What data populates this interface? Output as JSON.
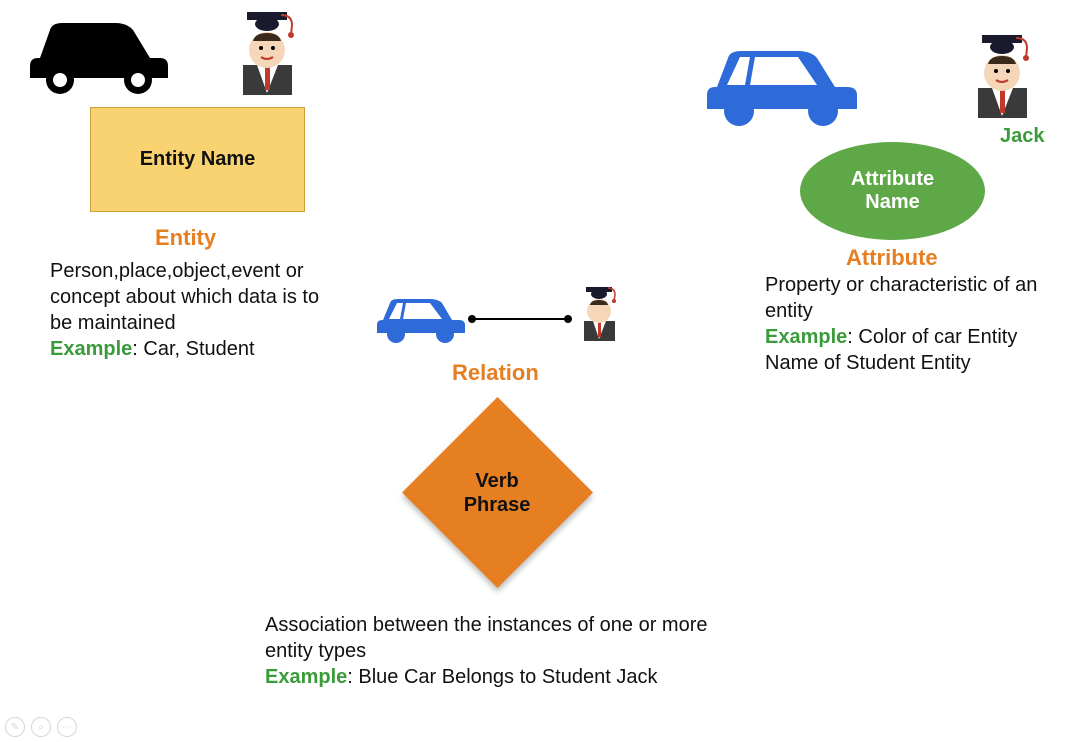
{
  "entity": {
    "box_label": "Entity Name",
    "section_label": "Entity",
    "description": "Person,place,object,event or concept about which data is to be maintained",
    "example_label": "Example",
    "example_text": ": Car, Student"
  },
  "attribute": {
    "ellipse_line1": "Attribute",
    "ellipse_line2": "Name",
    "section_label": "Attribute",
    "jack_label": "Jack",
    "description": "Property or characteristic of an entity",
    "example_label": "Example",
    "example_text": ": Color of car Entity Name of Student Entity"
  },
  "relation": {
    "diamond_line1": "Verb",
    "diamond_line2": "Phrase",
    "section_label": "Relation",
    "description": "Association between the instances of one or more entity types",
    "example_label": "Example",
    "example_text": ": Blue Car Belongs to Student Jack"
  }
}
